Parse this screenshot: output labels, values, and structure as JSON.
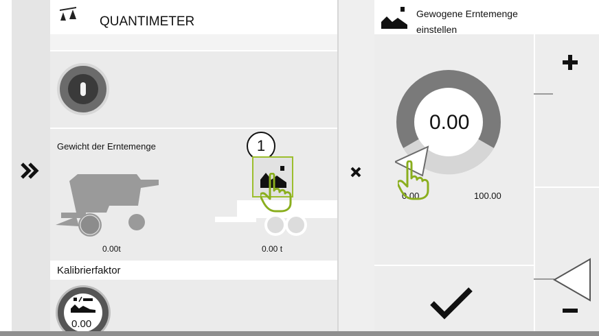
{
  "quantimeter": {
    "title": "QUANTIMETER",
    "title_icon": "scale-icon",
    "toggle_icon": "power-toggle-icon",
    "weight_label": "Gewicht der Erntemenge",
    "combine_value": "0.00",
    "combine_unit": "t",
    "trailer_value": "0.00 t",
    "callout_number": "1",
    "calib_label": "Kalibrierfaktor",
    "calib_value": "0.00",
    "calib_icon": "calibration-icon"
  },
  "nav": {
    "expand_icon": "double-chevron-right-icon",
    "close_icon": "close-icon"
  },
  "dialog": {
    "title_line1": "Gewogene Erntemenge",
    "title_line2": "einstellen",
    "dial_value": "0.00",
    "dial_level": 0.0,
    "min_label": "0.00",
    "max_label": "100.00",
    "plus_icon": "plus-icon",
    "minus_icon": "minus-icon",
    "confirm_icon": "checkmark-icon"
  },
  "colors": {
    "callout_highlight": "#9cbe2c",
    "dial_ring": "#7a7a7a",
    "icon_dark": "#222222"
  }
}
